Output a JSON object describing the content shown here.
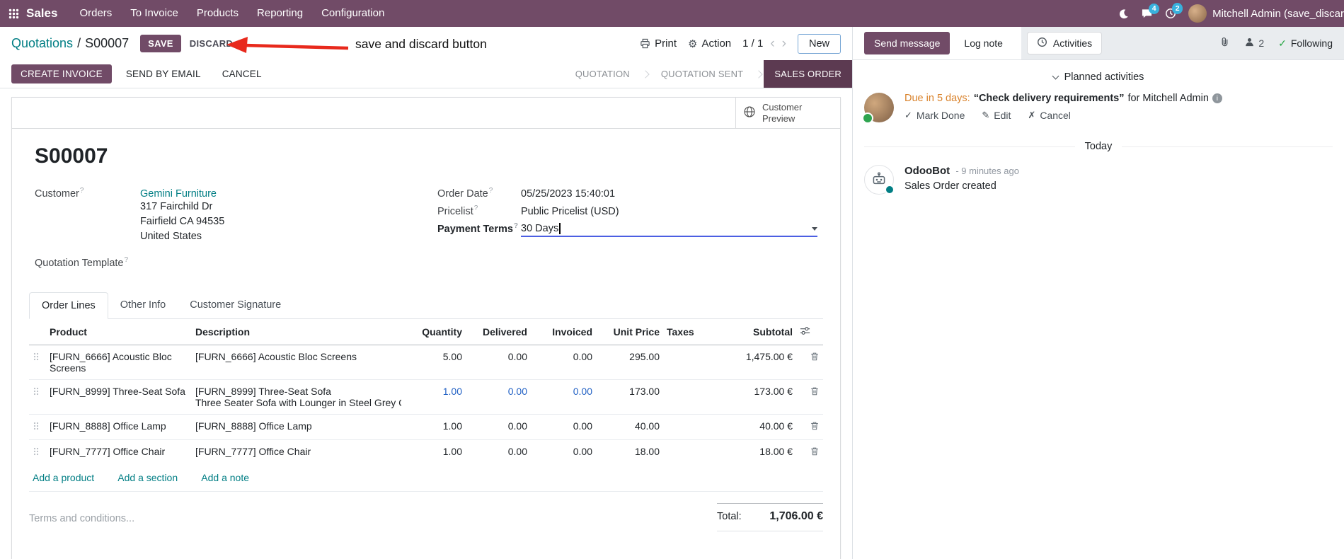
{
  "topbar": {
    "app_name": "Sales",
    "menus": [
      "Orders",
      "To Invoice",
      "Products",
      "Reporting",
      "Configuration"
    ],
    "messages_badge": "4",
    "activities_badge": "2",
    "user_name": "Mitchell Admin (save_discar"
  },
  "control_panel": {
    "breadcrumb_parent": "Quotations",
    "breadcrumb_separator": "/",
    "record_name": "S00007",
    "save_label": "SAVE",
    "discard_label": "DISCARD",
    "annotation_text": "save and discard button",
    "print_label": "Print",
    "action_label": "Action",
    "pager_value": "1 / 1",
    "new_label": "New"
  },
  "statusbar": {
    "create_invoice_label": "CREATE INVOICE",
    "send_by_email_label": "SEND BY EMAIL",
    "cancel_label": "CANCEL",
    "states": [
      "QUOTATION",
      "QUOTATION SENT",
      "SALES ORDER"
    ],
    "active_state": "SALES ORDER"
  },
  "form": {
    "customer_preview_label": "Customer Preview",
    "record_name": "S00007",
    "help_marker": "?",
    "customer": {
      "label": "Customer",
      "name": "Gemini Furniture",
      "address_lines": [
        "317 Fairchild Dr",
        "Fairfield CA 94535",
        "United States"
      ]
    },
    "quotation_template_label": "Quotation Template",
    "order_date": {
      "label": "Order Date",
      "value": "05/25/2023 15:40:01"
    },
    "pricelist": {
      "label": "Pricelist",
      "value": "Public Pricelist (USD)"
    },
    "payment_terms": {
      "label": "Payment Terms",
      "value": "30 Days"
    },
    "tabs": [
      "Order Lines",
      "Other Info",
      "Customer Signature"
    ],
    "active_tab": "Order Lines",
    "table": {
      "headers": [
        "Product",
        "Description",
        "Quantity",
        "Delivered",
        "Invoiced",
        "Unit Price",
        "Taxes",
        "Subtotal"
      ],
      "rows": [
        {
          "product": "[FURN_6666] Acoustic Bloc Screens",
          "description": [
            "[FURN_6666] Acoustic Bloc Screens"
          ],
          "quantity": "5.00",
          "delivered": "0.00",
          "invoiced": "0.00",
          "unit_price": "295.00",
          "taxes": "",
          "subtotal": "1,475.00 €",
          "modified": false
        },
        {
          "product": "[FURN_8999] Three-Seat Sofa",
          "description": [
            "[FURN_8999] Three-Seat Sofa",
            "Three Seater Sofa with Lounger in Steel Grey Colour"
          ],
          "quantity": "1.00",
          "delivered": "0.00",
          "invoiced": "0.00",
          "unit_price": "173.00",
          "taxes": "",
          "subtotal": "173.00 €",
          "modified": true
        },
        {
          "product": "[FURN_8888] Office Lamp",
          "description": [
            "[FURN_8888] Office Lamp"
          ],
          "quantity": "1.00",
          "delivered": "0.00",
          "invoiced": "0.00",
          "unit_price": "40.00",
          "taxes": "",
          "subtotal": "40.00 €",
          "modified": false
        },
        {
          "product": "[FURN_7777] Office Chair",
          "description": [
            "[FURN_7777] Office Chair"
          ],
          "quantity": "1.00",
          "delivered": "0.00",
          "invoiced": "0.00",
          "unit_price": "18.00",
          "taxes": "",
          "subtotal": "18.00 €",
          "modified": false
        }
      ],
      "add_links": [
        "Add a product",
        "Add a section",
        "Add a note"
      ]
    },
    "terms_placeholder": "Terms and conditions...",
    "total_label": "Total:",
    "total_value": "1,706.00 €"
  },
  "chatter": {
    "send_message_label": "Send message",
    "log_note_label": "Log note",
    "activities_label": "Activities",
    "followers_count": "2",
    "following_label": "Following",
    "planned_activities_title": "Planned activities",
    "activity": {
      "due_text": "Due in 5 days:",
      "summary": "“Check delivery requirements”",
      "assigned_text": "for Mitchell Admin",
      "mark_done_label": "Mark Done",
      "edit_label": "Edit",
      "cancel_label": "Cancel"
    },
    "date_separator": "Today",
    "message": {
      "author": "OdooBot",
      "timestamp": "- 9 minutes ago",
      "body": "Sales Order created"
    }
  },
  "icons": {
    "gear_glyph": "⚙",
    "check_glyph": "✓",
    "pencil_glyph": "✎",
    "cancel_glyph": "✗",
    "info_glyph": "i",
    "prev_glyph": "‹",
    "next_glyph": "›"
  },
  "colors": {
    "brand": "#714B67",
    "link": "#017e84",
    "active_state_bg": "#5c3a51",
    "modified_value": "#2160c4",
    "due_warning": "#d9822b",
    "annotation_red": "#e8291c",
    "badge_blue": "#38b1dd"
  }
}
